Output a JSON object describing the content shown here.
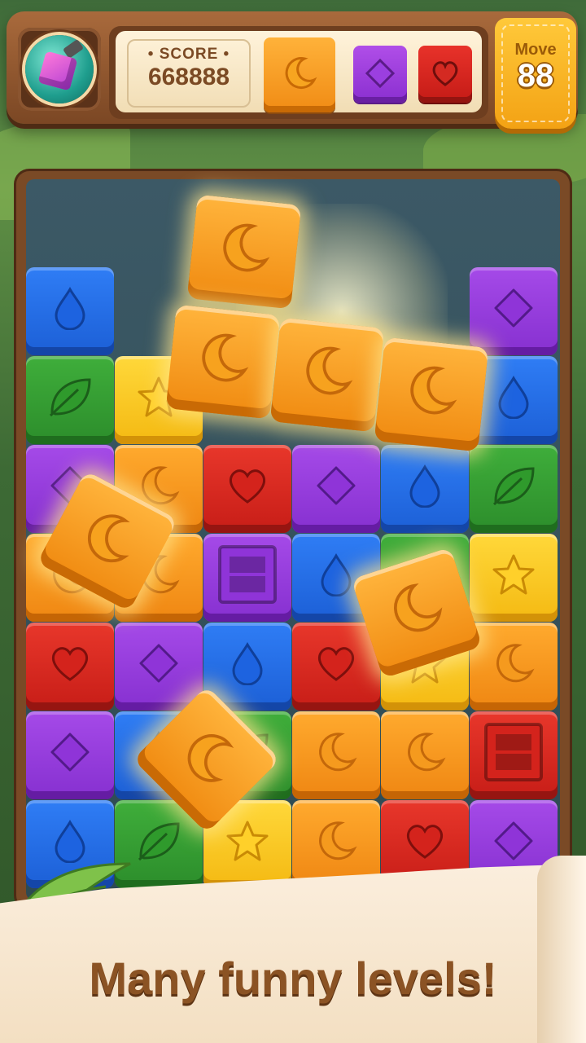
{
  "header": {
    "score_label": "• SCORE •",
    "score_value": "668888",
    "moves_label": "Move",
    "moves_value": "88",
    "goals": [
      {
        "color": "orange",
        "symbol": "moon-icon"
      },
      {
        "color": "purple",
        "symbol": "diamond-icon"
      },
      {
        "color": "red",
        "symbol": "heart-icon"
      }
    ]
  },
  "board": {
    "rows": [
      [
        "blue-drop",
        "none",
        "none",
        "none",
        "none",
        "purple-diamond"
      ],
      [
        "green-leaf",
        "yellow-star",
        "none",
        "none",
        "none",
        "blue-drop"
      ],
      [
        "purple-diamond",
        "orange-moon",
        "red-heart",
        "purple-diamond",
        "blue-drop",
        "green-leaf"
      ],
      [
        "orange-moon",
        "orange-moon",
        "purple-crate",
        "blue-drop",
        "green-leaf",
        "yellow-star"
      ],
      [
        "red-heart",
        "purple-diamond",
        "blue-drop",
        "red-heart",
        "yellow-star",
        "orange-moon"
      ],
      [
        "purple-diamond",
        "blue-drop",
        "green-leaf",
        "orange-moon",
        "orange-moon",
        "red-crate"
      ],
      [
        "blue-drop",
        "green-leaf",
        "yellow-star",
        "orange-moon",
        "red-heart",
        "purple-diamond"
      ]
    ],
    "floating_blocks": [
      "orange-moon",
      "orange-moon",
      "orange-moon",
      "orange-moon",
      "orange-moon",
      "orange-moon",
      "orange-moon"
    ]
  },
  "colors": {
    "blue": "#2f7df5",
    "green": "#3fae3b",
    "yellow": "#ffd83a",
    "purple": "#a54ae8",
    "red": "#e8372b",
    "orange": "#ffaa2e"
  },
  "banner": {
    "tagline": "Many funny levels!"
  }
}
